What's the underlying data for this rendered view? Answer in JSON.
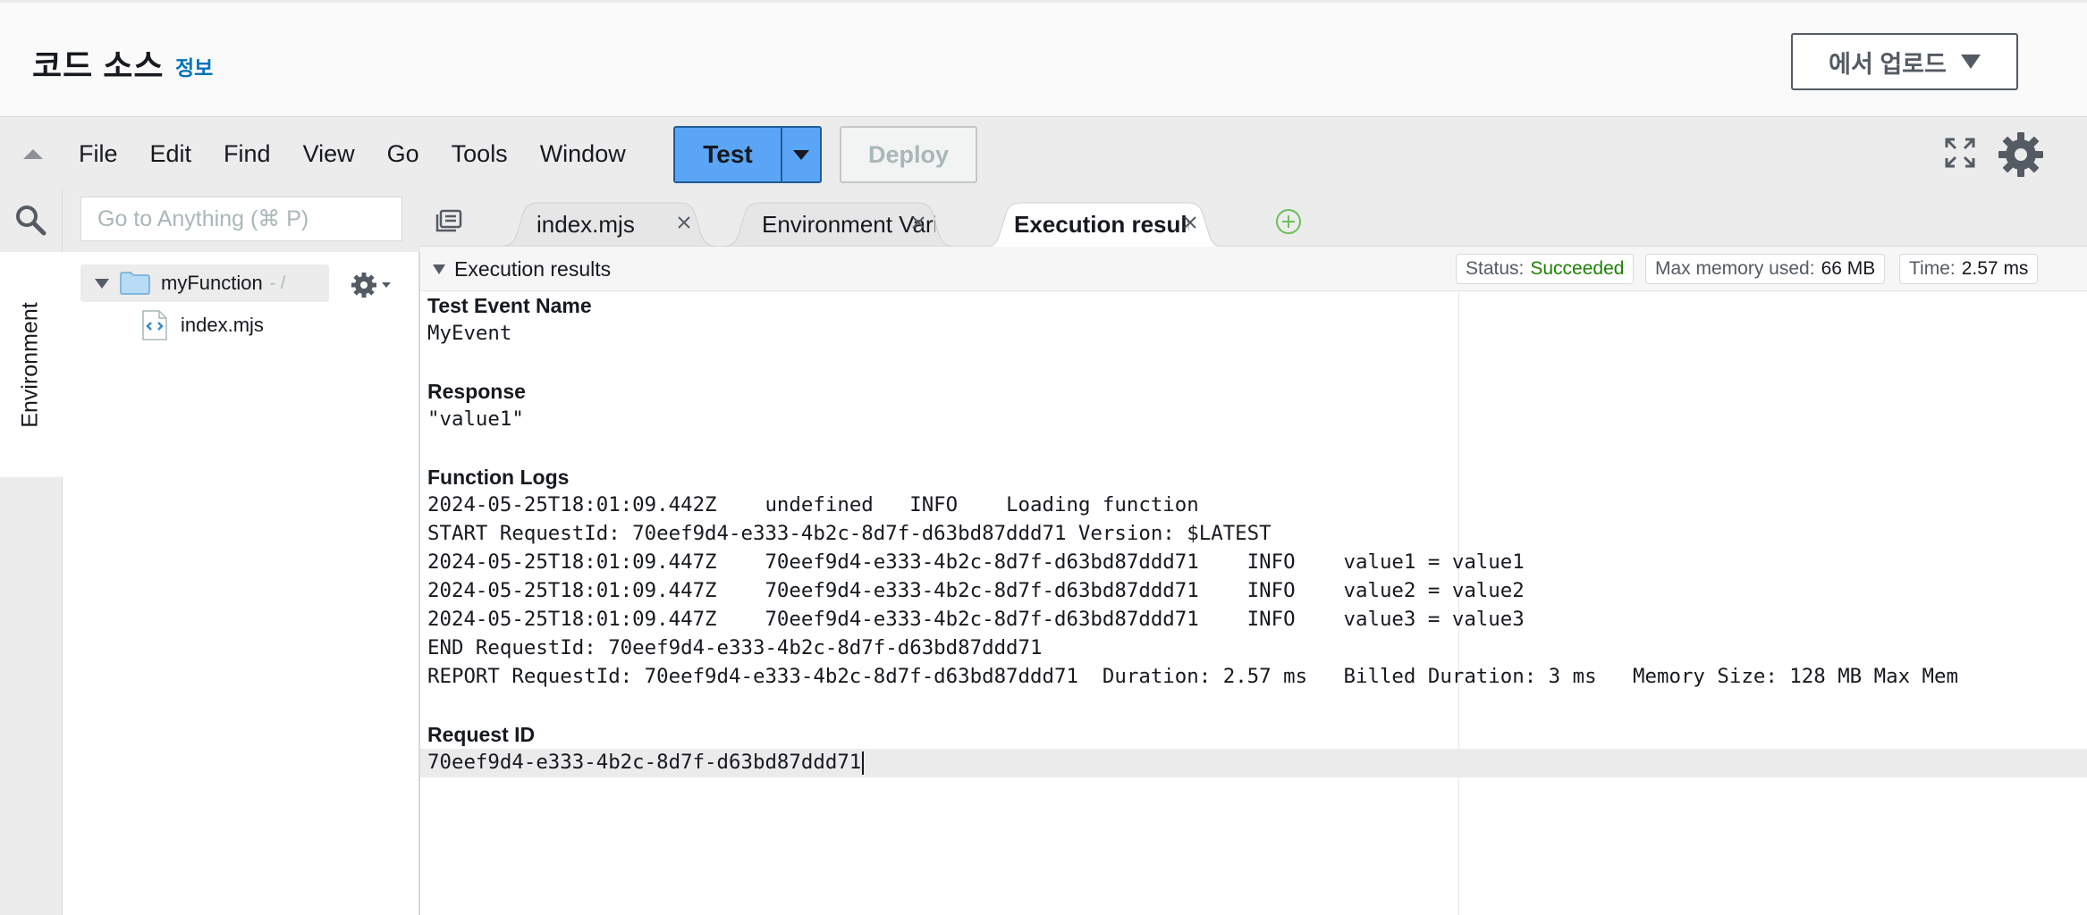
{
  "header": {
    "title": "코드 소스",
    "info_link": "정보",
    "upload_button": "에서 업로드"
  },
  "menubar": {
    "items": [
      "File",
      "Edit",
      "Find",
      "View",
      "Go",
      "Tools",
      "Window"
    ],
    "test_label": "Test",
    "deploy_label": "Deploy"
  },
  "sidebar": {
    "search_placeholder": "Go to Anything (⌘ P)",
    "environment_tab": "Environment",
    "tree": {
      "root_label": "myFunction",
      "root_path": "- /",
      "files": [
        "index.mjs"
      ]
    }
  },
  "tabs": [
    {
      "label": "index.mjs",
      "active": false
    },
    {
      "label": "Environment Vari",
      "active": false
    },
    {
      "label": "Execution results",
      "active": true
    }
  ],
  "results": {
    "toggle_label": "Execution results",
    "status_label": "Status:",
    "status_value": "Succeeded",
    "memory_label": "Max memory used:",
    "memory_value": "66 MB",
    "time_label": "Time:",
    "time_value": "2.57 ms",
    "test_event_heading": "Test Event Name",
    "test_event_value": "MyEvent",
    "response_heading": "Response",
    "response_value": "\"value1\"",
    "logs_heading": "Function Logs",
    "log_lines": [
      "2024-05-25T18:01:09.442Z\tundefined\tINFO\tLoading function",
      "START RequestId: 70eef9d4-e333-4b2c-8d7f-d63bd87ddd71 Version: $LATEST",
      "2024-05-25T18:01:09.447Z\t70eef9d4-e333-4b2c-8d7f-d63bd87ddd71\tINFO\tvalue1 = value1",
      "2024-05-25T18:01:09.447Z\t70eef9d4-e333-4b2c-8d7f-d63bd87ddd71\tINFO\tvalue2 = value2",
      "2024-05-25T18:01:09.447Z\t70eef9d4-e333-4b2c-8d7f-d63bd87ddd71\tINFO\tvalue3 = value3",
      "END RequestId: 70eef9d4-e333-4b2c-8d7f-d63bd87ddd71",
      "REPORT RequestId: 70eef9d4-e333-4b2c-8d7f-d63bd87ddd71\tDuration: 2.57 ms\tBilled Duration: 3 ms\tMemory Size: 128 MB\tMax Mem"
    ],
    "request_id_heading": "Request ID",
    "request_id_value": "70eef9d4-e333-4b2c-8d7f-d63bd87ddd71"
  },
  "colors": {
    "test_button": "#5aa5f5",
    "status_success": "#1d8102",
    "link": "#0073bb"
  },
  "icons": [
    "search-icon",
    "gear-icon",
    "fullscreen-icon",
    "folder-icon",
    "file-icon",
    "close-icon",
    "add-tab-icon",
    "tabs-menu-icon"
  ]
}
